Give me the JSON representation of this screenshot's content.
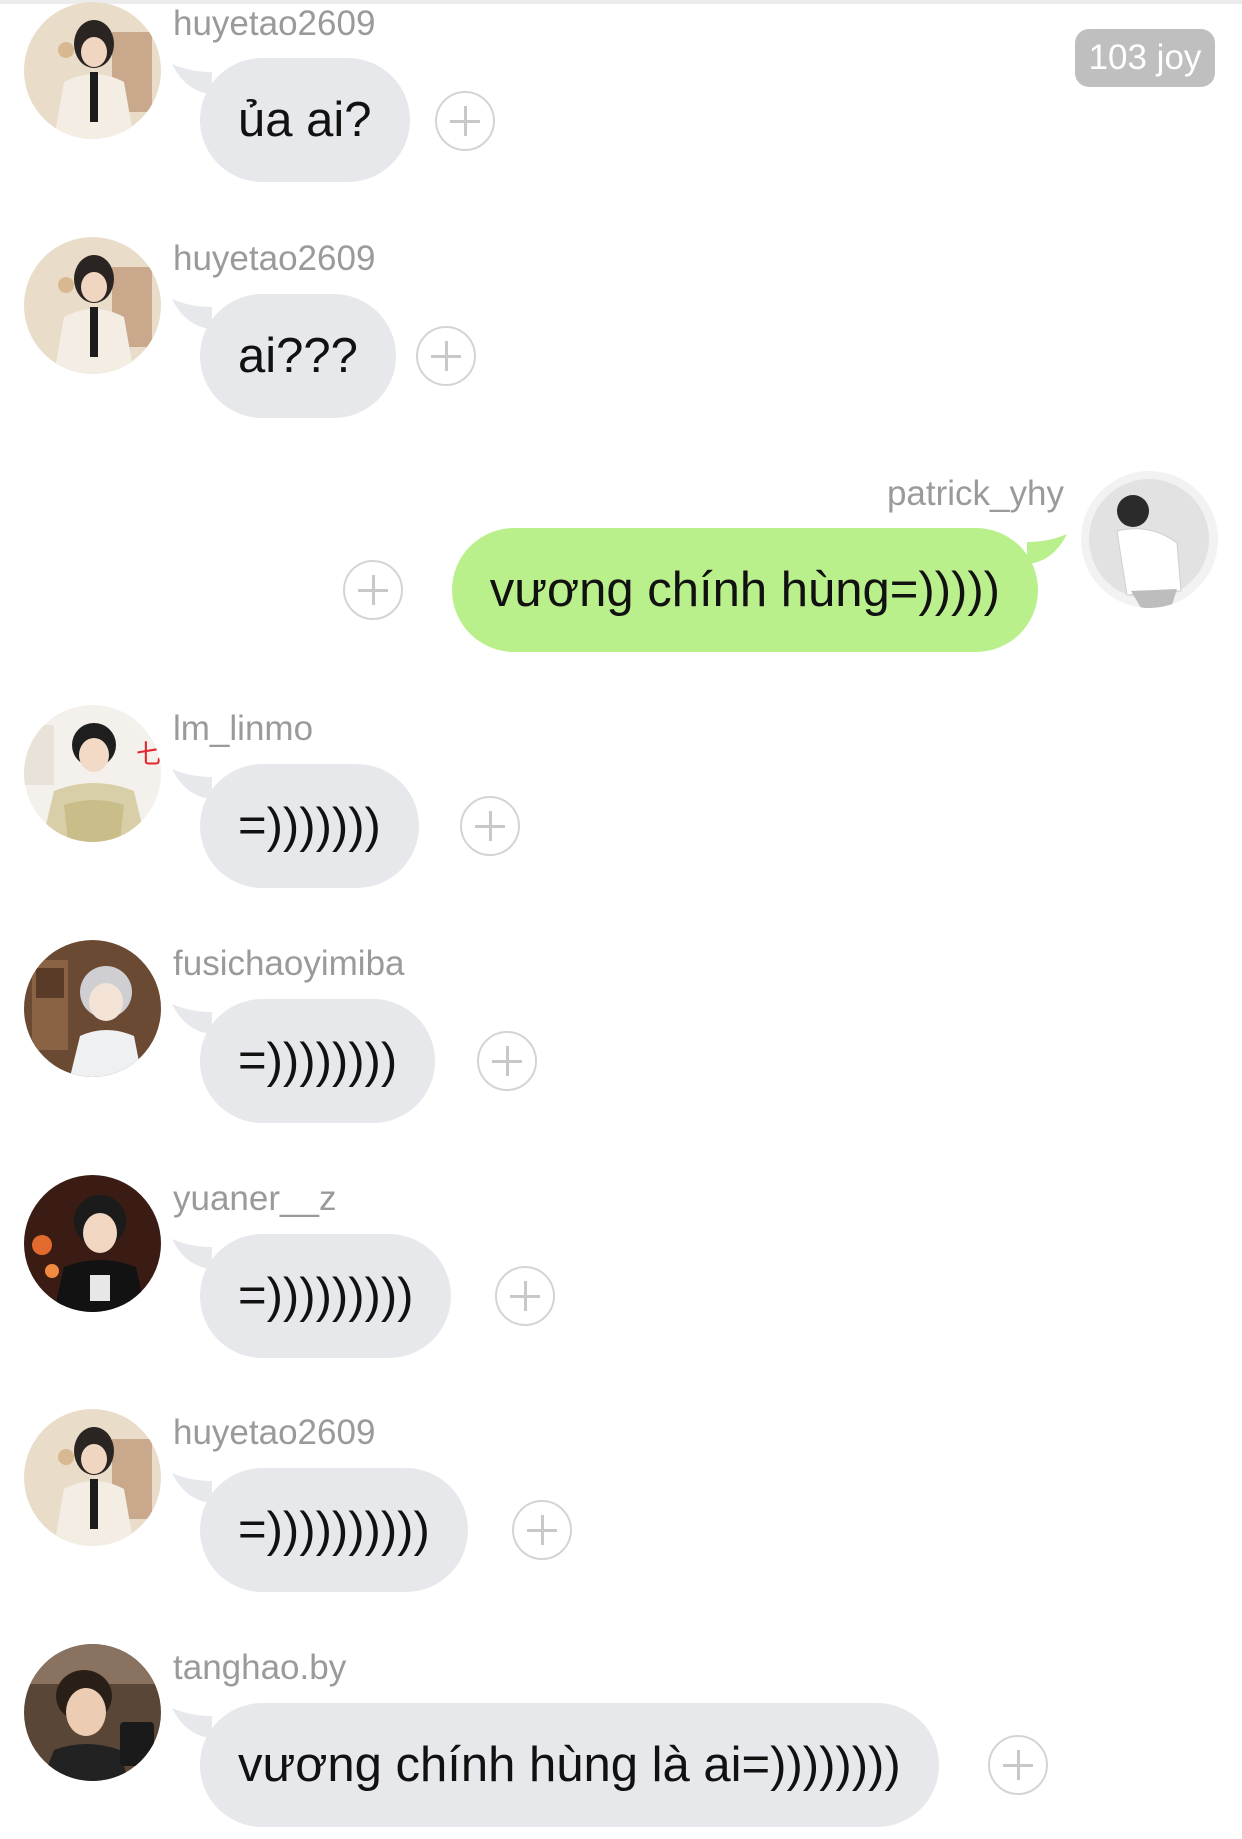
{
  "header": {
    "joy_count": "103 joy"
  },
  "messages": [
    {
      "sender": "huyetao2609",
      "text": "ủa ai?",
      "direction": "incoming"
    },
    {
      "sender": "huyetao2609",
      "text": "ai???",
      "direction": "incoming"
    },
    {
      "sender": "patrick_yhy",
      "text": "vương chính hùng=)))))",
      "direction": "outgoing"
    },
    {
      "sender": "lm_linmo",
      "text": "=)))))))",
      "direction": "incoming"
    },
    {
      "sender": "fusichaoyimiba",
      "text": "=))))))))",
      "direction": "incoming"
    },
    {
      "sender": "yuaner__z",
      "text": "=)))))))))",
      "direction": "incoming"
    },
    {
      "sender": "huyetao2609",
      "text": "=))))))))))",
      "direction": "incoming"
    },
    {
      "sender": "tanghao.by",
      "text": "vương chính hùng là ai=))))))))",
      "direction": "incoming"
    }
  ],
  "colors": {
    "incoming_bubble": "#e6e8eb",
    "outgoing_bubble": "#baf08c",
    "sender_name": "#9a9a9a",
    "badge_bg": "#bfbfbf"
  },
  "icons": {
    "add_reaction": "plus-circle-icon",
    "avatar": "user-avatar"
  }
}
